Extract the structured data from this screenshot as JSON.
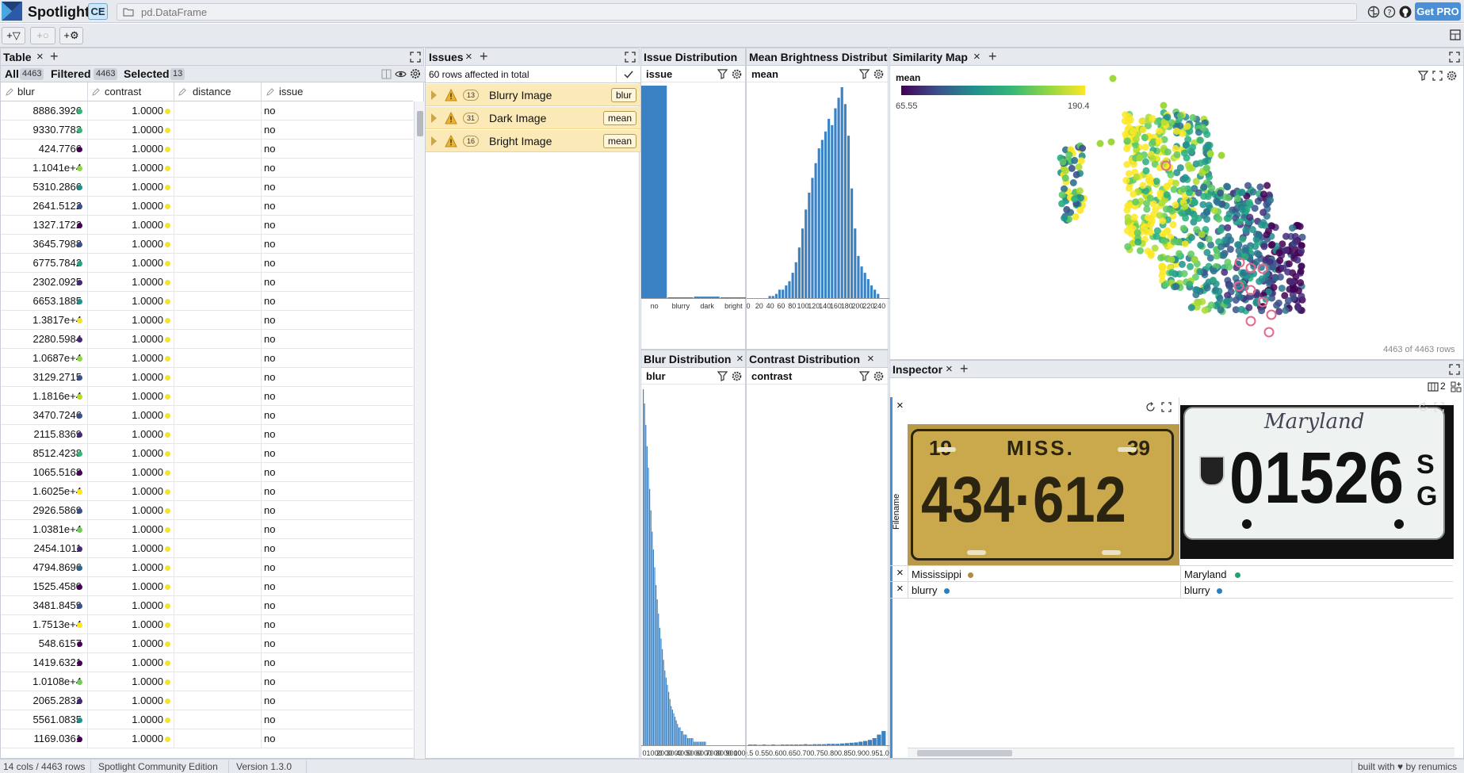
{
  "app": {
    "brand": "Spotlight",
    "edition_badge": "CE",
    "data_source": "pd.DataFrame",
    "get_pro": "Get PRO"
  },
  "toolbar": {
    "add_filter": "+▽",
    "add_similar": "+○",
    "add_tag": "+⚙"
  },
  "table": {
    "tab_title": "Table",
    "all_label": "All",
    "all_count": "4463",
    "filtered_label": "Filtered",
    "filtered_count": "4463",
    "selected_label": "Selected",
    "selected_count": "13",
    "columns": [
      "blur",
      "contrast",
      "distance",
      "issue"
    ],
    "rows": [
      {
        "blur": "8886.3926",
        "blur_color": "#35b779",
        "contrast": "1.0000",
        "issue": "no"
      },
      {
        "blur": "9330.7783",
        "blur_color": "#35b779",
        "contrast": "1.0000",
        "issue": "no"
      },
      {
        "blur": "424.7766",
        "blur_color": "#440154",
        "contrast": "1.0000",
        "issue": "no"
      },
      {
        "blur": "1.1041e+4",
        "blur_color": "#90d743",
        "contrast": "1.0000",
        "issue": "no"
      },
      {
        "blur": "5310.2866",
        "blur_color": "#21918c",
        "contrast": "1.0000",
        "issue": "no"
      },
      {
        "blur": "2641.5122",
        "blur_color": "#3b528b",
        "contrast": "1.0000",
        "issue": "no"
      },
      {
        "blur": "1327.1722",
        "blur_color": "#440154",
        "contrast": "1.0000",
        "issue": "no"
      },
      {
        "blur": "3645.7988",
        "blur_color": "#3b528b",
        "contrast": "1.0000",
        "issue": "no"
      },
      {
        "blur": "6775.7842",
        "blur_color": "#21a685",
        "contrast": "1.0000",
        "issue": "no"
      },
      {
        "blur": "2302.0925",
        "blur_color": "#482878",
        "contrast": "1.0000",
        "issue": "no"
      },
      {
        "blur": "6653.1885",
        "blur_color": "#21918c",
        "contrast": "1.0000",
        "issue": "no"
      },
      {
        "blur": "1.3817e+4",
        "blur_color": "#f3e336",
        "contrast": "1.0000",
        "issue": "no"
      },
      {
        "blur": "2280.5984",
        "blur_color": "#482878",
        "contrast": "1.0000",
        "issue": "no"
      },
      {
        "blur": "1.0687e+4",
        "blur_color": "#90d743",
        "contrast": "1.0000",
        "issue": "no"
      },
      {
        "blur": "3129.2715",
        "blur_color": "#3b528b",
        "contrast": "1.0000",
        "issue": "no"
      },
      {
        "blur": "1.1816e+4",
        "blur_color": "#b5de2b",
        "contrast": "1.0000",
        "issue": "no"
      },
      {
        "blur": "3470.7246",
        "blur_color": "#3b528b",
        "contrast": "1.0000",
        "issue": "no"
      },
      {
        "blur": "2115.8369",
        "blur_color": "#482878",
        "contrast": "1.0000",
        "issue": "no"
      },
      {
        "blur": "8512.4238",
        "blur_color": "#35b779",
        "contrast": "1.0000",
        "issue": "no"
      },
      {
        "blur": "1065.5168",
        "blur_color": "#440154",
        "contrast": "1.0000",
        "issue": "no"
      },
      {
        "blur": "1.6025e+4",
        "blur_color": "#fde725",
        "contrast": "1.0000",
        "issue": "no"
      },
      {
        "blur": "2926.5869",
        "blur_color": "#3b528b",
        "contrast": "1.0000",
        "issue": "no"
      },
      {
        "blur": "1.0381e+4",
        "blur_color": "#6ece58",
        "contrast": "1.0000",
        "issue": "no"
      },
      {
        "blur": "2454.1011",
        "blur_color": "#482878",
        "contrast": "1.0000",
        "issue": "no"
      },
      {
        "blur": "4794.8696",
        "blur_color": "#31688e",
        "contrast": "1.0000",
        "issue": "no"
      },
      {
        "blur": "1525.4580",
        "blur_color": "#440154",
        "contrast": "1.0000",
        "issue": "no"
      },
      {
        "blur": "3481.8459",
        "blur_color": "#3b528b",
        "contrast": "1.0000",
        "issue": "no"
      },
      {
        "blur": "1.7513e+4",
        "blur_color": "#fde725",
        "contrast": "1.0000",
        "issue": "no"
      },
      {
        "blur": "548.6157",
        "blur_color": "#440154",
        "contrast": "1.0000",
        "issue": "no"
      },
      {
        "blur": "1419.6321",
        "blur_color": "#440154",
        "contrast": "1.0000",
        "issue": "no"
      },
      {
        "blur": "1.0108e+4",
        "blur_color": "#6ece58",
        "contrast": "1.0000",
        "issue": "no"
      },
      {
        "blur": "2065.2832",
        "blur_color": "#482878",
        "contrast": "1.0000",
        "issue": "no"
      },
      {
        "blur": "5561.0835",
        "blur_color": "#21918c",
        "contrast": "1.0000",
        "issue": "no"
      },
      {
        "blur": "1169.0361",
        "blur_color": "#440154",
        "contrast": "1.0000",
        "issue": "no"
      }
    ]
  },
  "issues": {
    "tab_title": "Issues",
    "summary": "60 rows affected in total",
    "items": [
      {
        "count": "13",
        "name": "Blurry Image",
        "chip": "blur"
      },
      {
        "count": "31",
        "name": "Dark Image",
        "chip": "mean"
      },
      {
        "count": "16",
        "name": "Bright Image",
        "chip": "mean"
      }
    ]
  },
  "issue_dist": {
    "tab_title": "Issue Distribution",
    "column": "issue"
  },
  "brightness_dist": {
    "tab_title": "Mean Brightness Distribut",
    "column": "mean"
  },
  "blur_dist": {
    "tab_title": "Blur Distribution",
    "column": "blur"
  },
  "contrast_dist": {
    "tab_title": "Contrast Distribution",
    "column": "contrast"
  },
  "chart_data": [
    {
      "type": "bar",
      "title": "Issue Distribution",
      "xlabel": "issue",
      "categories": [
        "no",
        "blurry",
        "dark",
        "bright"
      ],
      "values": [
        4403,
        13,
        31,
        16
      ]
    },
    {
      "type": "bar",
      "title": "Mean Brightness Distribut",
      "xlabel": "mean",
      "tick_labels": [
        "0",
        "20",
        "40",
        "60",
        "80",
        "100",
        "120",
        "140",
        "160",
        "180",
        "200",
        "220",
        "240"
      ],
      "xlim": [
        0,
        255
      ],
      "bin_centers": [
        40,
        46,
        52,
        58,
        64,
        70,
        76,
        82,
        88,
        94,
        100,
        106,
        112,
        118,
        124,
        130,
        136,
        142,
        148,
        154,
        160,
        166,
        172,
        178,
        184,
        190,
        196,
        202,
        208,
        214,
        220,
        226,
        232,
        238
      ],
      "values": [
        0.01,
        0.01,
        0.02,
        0.04,
        0.04,
        0.06,
        0.08,
        0.12,
        0.17,
        0.24,
        0.33,
        0.42,
        0.5,
        0.57,
        0.64,
        0.71,
        0.75,
        0.79,
        0.85,
        0.82,
        0.9,
        0.95,
        1.0,
        0.92,
        0.77,
        0.52,
        0.33,
        0.2,
        0.15,
        0.12,
        0.09,
        0.06,
        0.04,
        0.02
      ]
    },
    {
      "type": "bar",
      "title": "Blur Distribution",
      "xlabel": "blur",
      "tick_labels": [
        "0",
        "1000",
        "2000",
        "3000",
        "4000",
        "5000",
        "6000",
        "7000",
        "8000",
        "9000",
        "10000"
      ],
      "values": [
        1.0,
        0.96,
        0.9,
        0.84,
        0.78,
        0.72,
        0.66,
        0.6,
        0.55,
        0.5,
        0.45,
        0.41,
        0.37,
        0.33,
        0.3,
        0.27,
        0.24,
        0.21,
        0.19,
        0.17,
        0.15,
        0.13,
        0.11,
        0.1,
        0.09,
        0.08,
        0.07,
        0.06,
        0.05,
        0.05,
        0.04,
        0.04,
        0.03,
        0.03,
        0.03,
        0.02,
        0.02,
        0.02,
        0.02,
        0.02,
        0.01,
        0.01,
        0.01,
        0.01,
        0.01,
        0.01,
        0.01,
        0.01,
        0.01,
        0.01
      ]
    },
    {
      "type": "bar",
      "title": "Contrast Distribution",
      "xlabel": "contrast",
      "tick_labels": [
        "0.5",
        "0.55",
        "0.60",
        "0.65",
        "0.70",
        "0.75",
        "0.80",
        "0.85",
        "0.90",
        "0.95",
        "1.00"
      ],
      "xlim": [
        0.5,
        1.0
      ],
      "values": [
        0.002,
        0.002,
        0.001,
        0.002,
        0.001,
        0.002,
        0.001,
        0.002,
        0.002,
        0.002,
        0.002,
        0.002,
        0.003,
        0.002,
        0.003,
        0.003,
        0.003,
        0.004,
        0.004,
        0.004,
        0.005,
        0.006,
        0.007,
        0.008,
        0.01,
        0.012,
        0.015,
        0.02,
        0.03,
        0.04
      ]
    }
  ],
  "similarity": {
    "tab_title": "Similarity Map",
    "color_by": "mean",
    "scale_min": "65.55",
    "scale_max": "190.4",
    "rows_info": "4463 of 4463 rows"
  },
  "inspector": {
    "tab_title": "Inspector",
    "column_count": "2",
    "field_label": "Filename",
    "cards": [
      {
        "plate_top_left": "19",
        "plate_state": "MISS.",
        "plate_top_right": "39",
        "plate_number": "434·612",
        "label": "Mississippi",
        "label_color": "#b08a3a",
        "issue": "blurry",
        "issue_color": "#2a7fc1"
      },
      {
        "plate_state": "Maryland",
        "plate_number": "01526",
        "plate_suffix_1": "S",
        "plate_suffix_2": "G",
        "label": "Maryland",
        "label_color": "#2a9d6f",
        "issue": "blurry",
        "issue_color": "#2a7fc1"
      }
    ]
  },
  "footer": {
    "cols_rows": "14 cols / 4463 rows",
    "edition": "Spotlight Community Edition",
    "version": "Version 1.3.0",
    "built_with": "built with ♥ by renumics"
  },
  "colors": {
    "accent": "#4a90d9",
    "issue_bg": "#fbe9b7",
    "bar": "#3b82c4",
    "contrast_dot": "#f3e336"
  }
}
